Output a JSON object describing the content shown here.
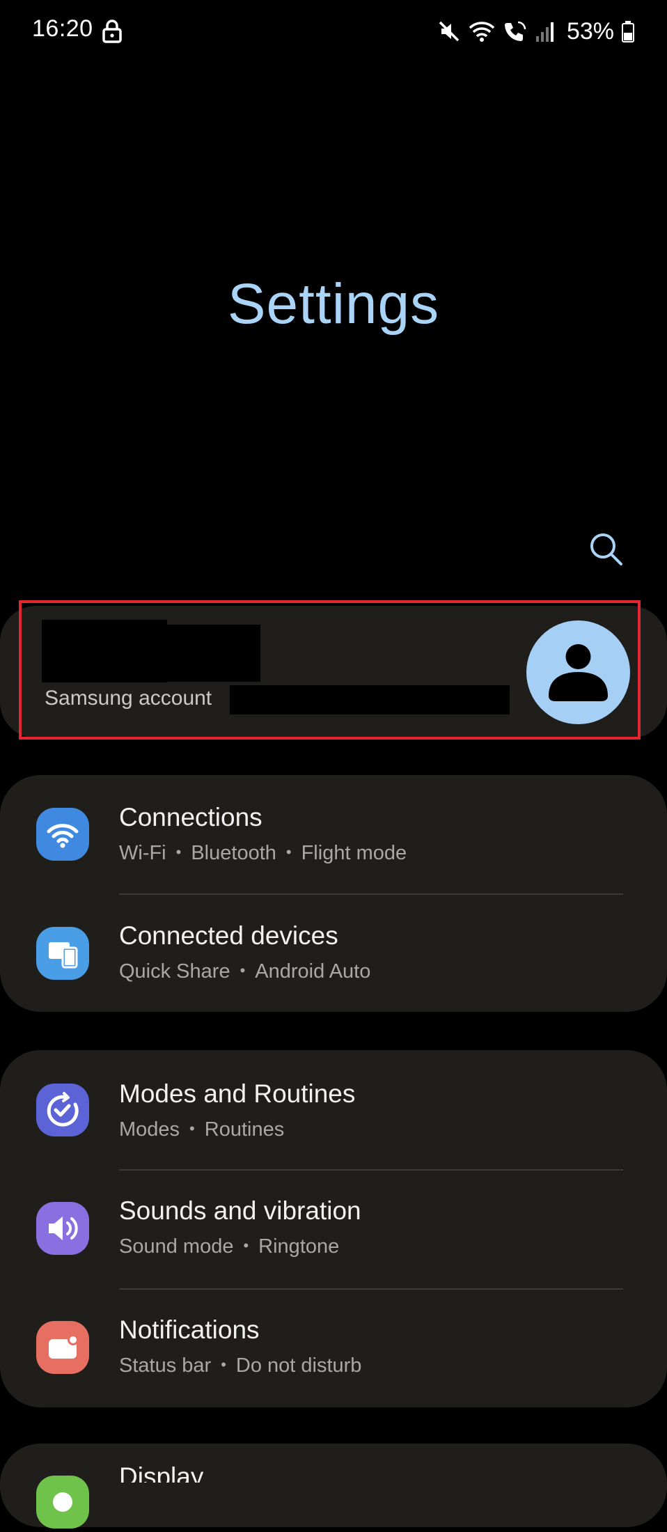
{
  "status_bar": {
    "time": "16:20",
    "battery": "53%",
    "icons": [
      "lock-icon",
      "mute-icon",
      "wifi-icon",
      "wifi-calling-icon",
      "signal-icon",
      "battery-icon"
    ]
  },
  "header": {
    "title": "Settings",
    "search_icon": "search-icon"
  },
  "account": {
    "label": "Samsung account",
    "avatar_icon": "person-icon"
  },
  "colors": {
    "title": "#a9d3f7",
    "card": "#1f1e1b",
    "highlight": "#e3262f",
    "avatar": "#a5cff4"
  },
  "groups": [
    {
      "items": [
        {
          "title": "Connections",
          "sub": [
            "Wi-Fi",
            "Bluetooth",
            "Flight mode"
          ],
          "icon": "wifi-icon",
          "color": "#3f8ae0"
        },
        {
          "title": "Connected devices",
          "sub": [
            "Quick Share",
            "Android Auto"
          ],
          "icon": "devices-icon",
          "color": "#4a9ee6"
        }
      ]
    },
    {
      "items": [
        {
          "title": "Modes and Routines",
          "sub": [
            "Modes",
            "Routines"
          ],
          "icon": "modes-check-icon",
          "color": "#5b63d6"
        },
        {
          "title": "Sounds and vibration",
          "sub": [
            "Sound mode",
            "Ringtone"
          ],
          "icon": "speaker-icon",
          "color": "#8a6fe0"
        },
        {
          "title": "Notifications",
          "sub": [
            "Status bar",
            "Do not disturb"
          ],
          "icon": "notification-icon",
          "color": "#e76f62"
        }
      ]
    },
    {
      "items": [
        {
          "title": "Display",
          "icon": "display-icon",
          "color": "#6fc24a"
        }
      ]
    }
  ]
}
